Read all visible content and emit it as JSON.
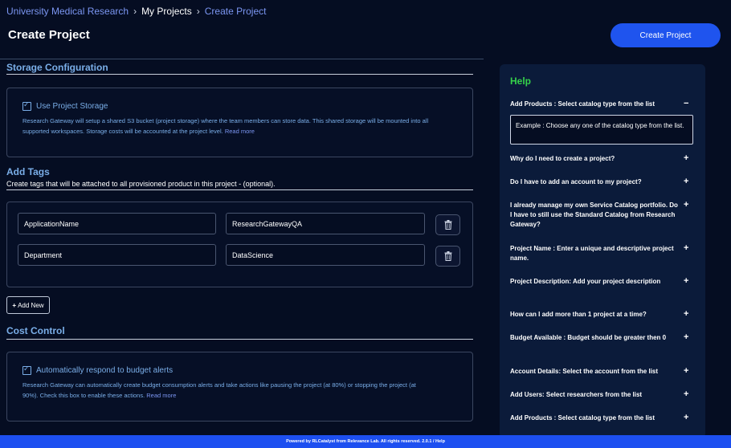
{
  "breadcrumb": {
    "items": [
      "University Medical Research",
      "My Projects",
      "Create Project"
    ],
    "separator": "›"
  },
  "page": {
    "title": "Create Project",
    "create_button": "Create Project"
  },
  "storage": {
    "title": "Storage Configuration",
    "checkbox_label": "Use Project Storage",
    "checked": true,
    "description_line1": "Research Gateway will setup a shared S3 bucket (project storage) where the team members can store data. This shared storage will be mounted into all",
    "description_line2": "supported workspaces. Storage costs will be accounted at the project level.",
    "read_more": "Read more"
  },
  "tags": {
    "title": "Add Tags",
    "subtitle": "Create tags that will be attached to all provisioned product in this project - (optional).",
    "rows": [
      {
        "key": "ApplicationName",
        "value": "ResearchGatewayQA"
      },
      {
        "key": "Department",
        "value": "DataScience"
      }
    ],
    "add_new_label": "Add New"
  },
  "cost": {
    "title": "Cost Control",
    "checkbox_label": "Automatically respond to budget alerts",
    "checked": true,
    "description_line1": "Research Gateway can automatically create budget consumption alerts and take actions like pausing the project (at 80%) or stopping the project (at",
    "description_line2": "90%). Check this box to enable these actions.",
    "read_more": "Read more"
  },
  "help": {
    "title": "Help",
    "items": [
      {
        "question": "Add Products : Select catalog type from the list",
        "sign": "−",
        "answer": "Example : Choose any one of the catalog type from the list."
      },
      {
        "question": "Why do I need to create a project?",
        "sign": "+"
      },
      {
        "question": "Do I have to add an account to my project?",
        "sign": "+"
      },
      {
        "question": "I already manage my own Service Catalog portfolio. Do I have to still use the Standard Catalog from Research Gateway?",
        "sign": "+"
      },
      {
        "question": "Project Name : Enter a unique and descriptive project name.",
        "sign": "+"
      },
      {
        "question": "Project Description: Add your project description",
        "sign": "+"
      },
      {
        "question": "How can I add more than 1 project at a time?",
        "sign": "+"
      },
      {
        "question": "Budget Available : Budget should be greater then 0",
        "sign": "+"
      },
      {
        "question": "Account Details: Select the account from the list",
        "sign": "+"
      },
      {
        "question": "Add Users: Select researchers from the list",
        "sign": "+"
      },
      {
        "question": "Add Products : Select catalog type from the list",
        "sign": "+"
      }
    ]
  },
  "footer": {
    "text": "Powered by RLCatalyst from Relevance Lab. All rights reserved. 2.0.1 / Help"
  },
  "colors": {
    "background": "#050d22",
    "accent": "#1f54ee",
    "section_title": "#7aaee8",
    "help_title": "#35d24a",
    "help_panel": "#0b1b3a"
  }
}
